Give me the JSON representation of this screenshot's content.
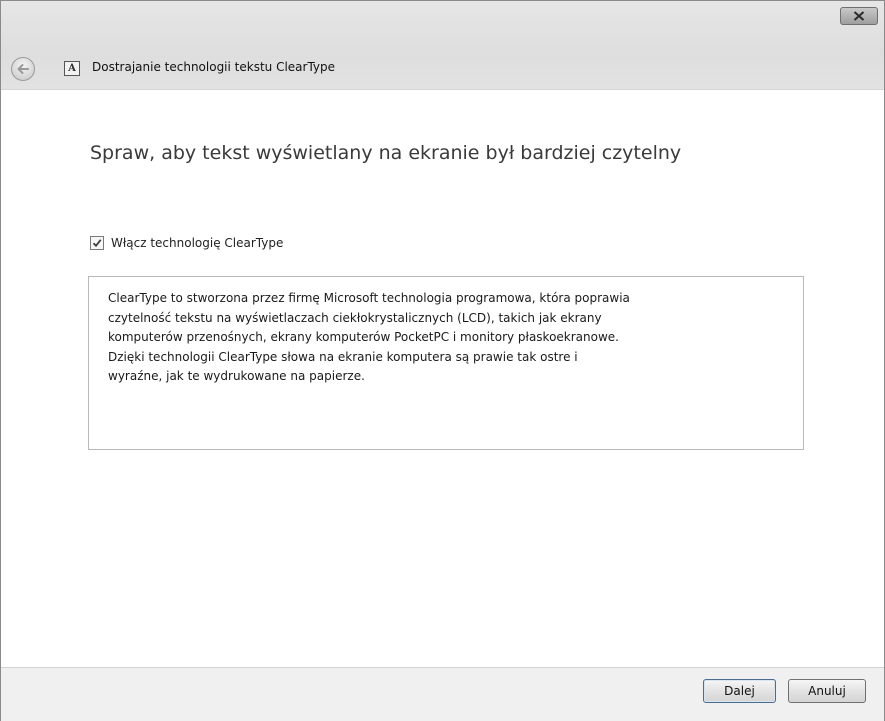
{
  "window": {
    "title": "Dostrajanie technologii tekstu ClearType",
    "app_icon_glyph": "A",
    "close_icon": "close-icon",
    "back_icon": "back-arrow-icon"
  },
  "content": {
    "heading": "Spraw, aby tekst wyświetlany na ekranie był bardziej czytelny",
    "checkbox": {
      "label": "Włącz technologię ClearType",
      "checked": true
    },
    "description": "ClearType to stworzona przez firmę Microsoft technologia programowa, która poprawia\nczytelność tekstu na wyświetlaczach ciekłokrystalicznych (LCD), takich jak ekrany\nkomputerów przenośnych, ekrany komputerów PocketPC i monitory płaskoekranowe.\nDzięki technologii ClearType słowa na ekranie komputera są prawie tak ostre i\nwyraźne, jak te wydrukowane na papierze."
  },
  "footer": {
    "next_label": "Dalej",
    "cancel_label": "Anuluj"
  }
}
